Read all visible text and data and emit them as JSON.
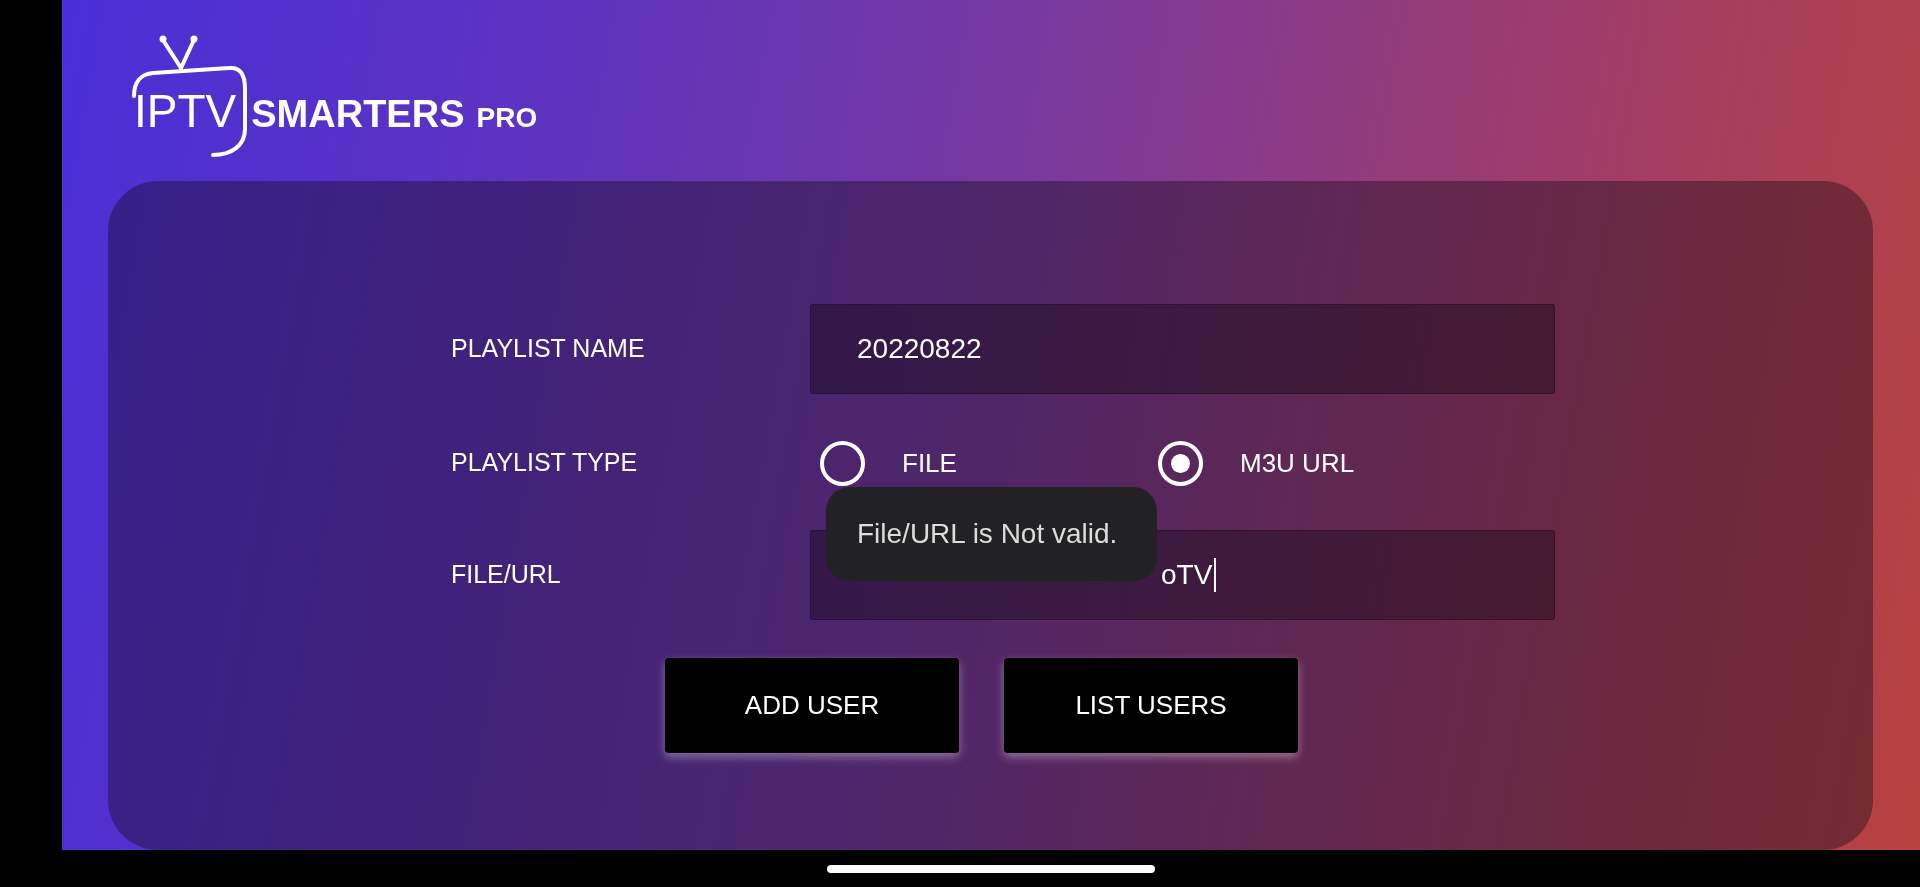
{
  "logo": {
    "brand": "IPTV",
    "name": "SMARTERS",
    "edition": "PRO"
  },
  "form": {
    "playlist_name": {
      "label": "PLAYLIST NAME",
      "value": "20220822"
    },
    "playlist_type": {
      "label": "PLAYLIST TYPE",
      "options": [
        {
          "label": "FILE",
          "selected": false
        },
        {
          "label": "M3U URL",
          "selected": true
        }
      ]
    },
    "file_url": {
      "label": "FILE/URL",
      "value": "oTV",
      "focused": true
    }
  },
  "toast": {
    "message": "File/URL is Not valid."
  },
  "buttons": [
    {
      "label": "ADD USER"
    },
    {
      "label": "LIST USERS"
    }
  ]
}
